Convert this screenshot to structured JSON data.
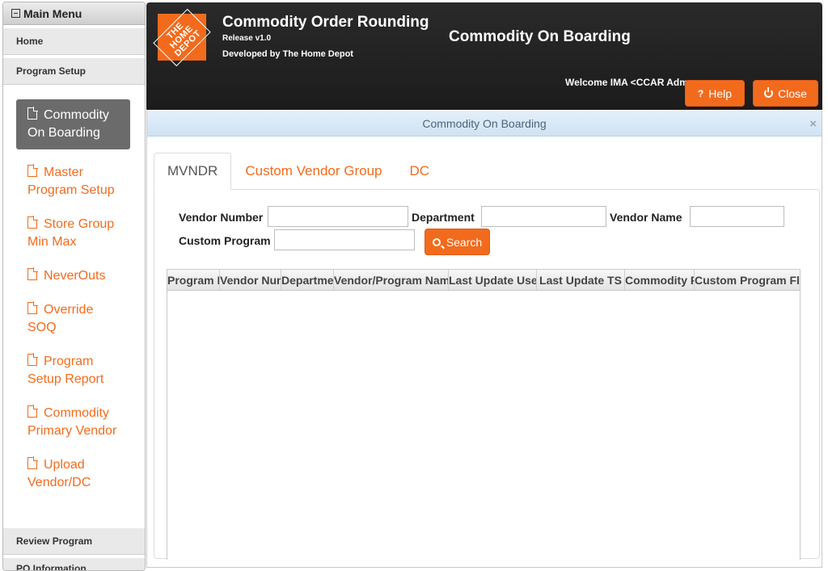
{
  "sidebar": {
    "header": "Main Menu",
    "sections": [
      "Home",
      "Program Setup"
    ],
    "items": [
      {
        "line1": "Commodity",
        "line2": "On Boarding",
        "active": true
      },
      {
        "line1": "Master",
        "line2": "Program Setup"
      },
      {
        "line1": "Store Group",
        "line2": "Min Max"
      },
      {
        "line1": "NeverOuts",
        "line2": ""
      },
      {
        "line1": "Override",
        "line2": "SOQ"
      },
      {
        "line1": "Program",
        "line2": "Setup Report"
      },
      {
        "line1": "Commodity",
        "line2": "Primary Vendor"
      },
      {
        "line1": "Upload",
        "line2": "Vendor/DC"
      }
    ],
    "bottom_sections": [
      "Review Program",
      "PO Information"
    ]
  },
  "header": {
    "logo_text": "THE HOME DEPOT",
    "app_title": "Commodity Order Rounding",
    "release": "Release v1.0",
    "developed": "Developed by The Home Depot",
    "page_heading": "Commodity On Boarding",
    "welcome": "Welcome IMA <CCAR Admin>",
    "help_label": "Help",
    "close_label": "Close",
    "accent_color": "#f26b1d"
  },
  "panel": {
    "title": "Commodity On Boarding",
    "close_glyph": "×",
    "tabs": [
      "MVNDR",
      "Custom Vendor Group",
      "DC"
    ],
    "active_tab": "MVNDR"
  },
  "form": {
    "vendor_number_label": "Vendor Number",
    "vendor_number_value": "",
    "department_label": "Department",
    "department_value": "",
    "vendor_name_label": "Vendor Name",
    "vendor_name_value": "",
    "custom_program_label": "Custom Program",
    "custom_program_value": "",
    "search_label": "Search"
  },
  "grid": {
    "columns": [
      "Program ID",
      "Vendor Number",
      "Department",
      "Vendor/Program Name",
      "Last Update User ID",
      "Last Update TS",
      "Commodity Flag",
      "Custom Program Flag"
    ],
    "rows": []
  }
}
